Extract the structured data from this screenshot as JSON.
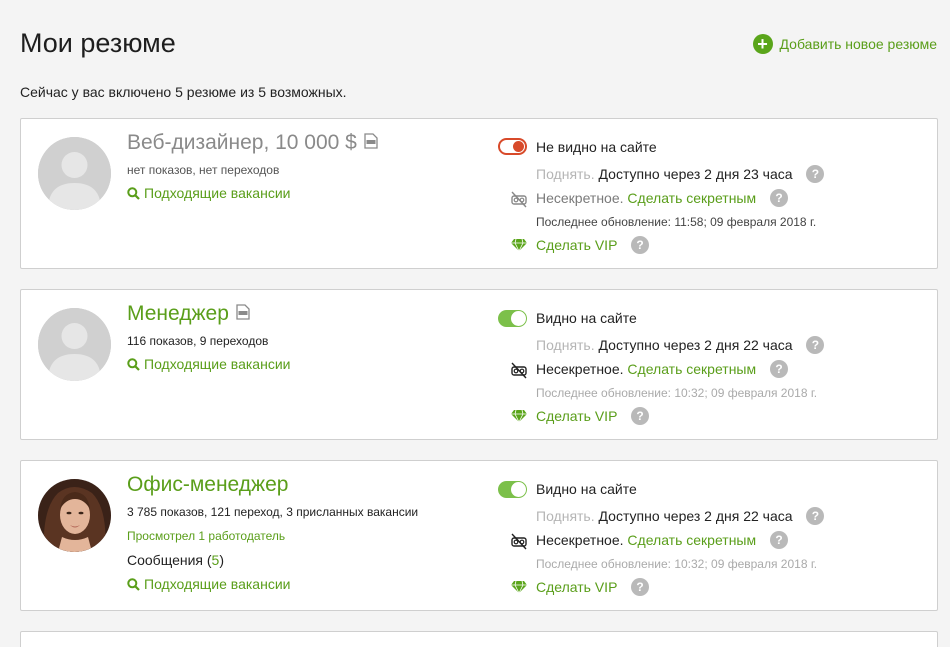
{
  "header": {
    "title": "Мои резюме",
    "add_label": "Добавить новое резюме",
    "info": "Сейчас у вас включено 5 резюме из 5 возможных."
  },
  "resumes": [
    {
      "title": "Веб-дизайнер, 10 000 $",
      "stats": "нет показов, нет переходов",
      "vacancies_label": "Подходящие вакансии",
      "visibility_label": "Не видно на сайте",
      "visible": false,
      "lift_label": "Поднять.",
      "lift_available": "Доступно через 2 дня 23 часа",
      "secret_status": "Несекретное.",
      "secret_link": "Сделать секретным",
      "updated": "Последнее обновление: 11:58; 09 февраля 2018 г.",
      "vip_label": "Сделать VIP"
    },
    {
      "title": "Менеджер",
      "stats": "116 показов, 9 переходов",
      "vacancies_label": "Подходящие вакансии",
      "visibility_label": "Видно на сайте",
      "visible": true,
      "lift_label": "Поднять.",
      "lift_available": "Доступно через 2 дня 22 часа",
      "secret_status": "Несекретное.",
      "secret_link": "Сделать секретным",
      "updated": "Последнее обновление: 10:32; 09 февраля 2018 г.",
      "vip_label": "Сделать VIP"
    },
    {
      "title": "Офис-менеджер",
      "stats": "3 785 показов, 121 переход, 3 присланных вакансии",
      "viewed": "Просмотрел 1 работодатель",
      "messages_label": "Сообщения",
      "messages_count": "5",
      "vacancies_label": "Подходящие вакансии",
      "visibility_label": "Видно на сайте",
      "visible": true,
      "lift_label": "Поднять.",
      "lift_available": "Доступно через 2 дня 22 часа",
      "secret_status": "Несекретное.",
      "secret_link": "Сделать секретным",
      "updated": "Последнее обновление: 10:32; 09 февраля 2018 г.",
      "vip_label": "Сделать VIP"
    }
  ],
  "help_glyph": "?",
  "colors": {
    "accent_green": "#5a9e1a",
    "toggle_off": "#d84a2a",
    "toggle_on": "#7cc04a"
  },
  "icons": [
    "add-icon",
    "document-icon",
    "search-icon",
    "secret-off-icon",
    "diamond-icon",
    "help-icon",
    "toggle-switch"
  ]
}
